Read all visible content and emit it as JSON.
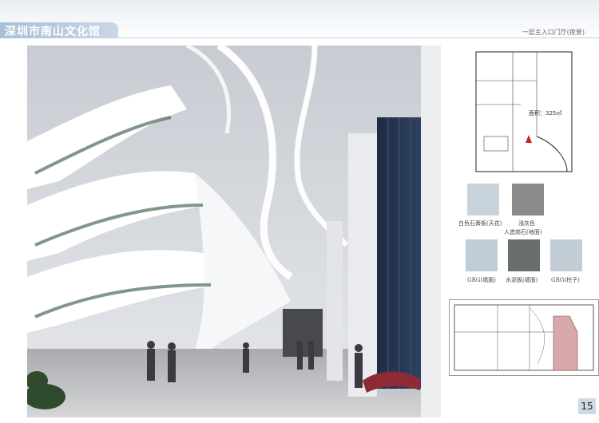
{
  "header": {
    "title": "深圳市南山文化馆",
    "subtitle": "一层主入口门厅(夜景)"
  },
  "plan": {
    "area_label": "面积：325㎡"
  },
  "materials": [
    {
      "label": "白色石膏板(天花)",
      "color": "#c9d3db"
    },
    {
      "label": "浅灰色",
      "color": "#8a8b8a"
    },
    {
      "label": "人造岗石(地面)",
      "color": ""
    },
    {
      "label": "GRG(墙面)",
      "color": "#c0ccd6"
    },
    {
      "label": "水泥板(墙面)",
      "color": "#6a6d6e"
    },
    {
      "label": "GRG(柱子)",
      "color": "#c3cdd5"
    }
  ],
  "footer": {
    "page_number": "15"
  }
}
